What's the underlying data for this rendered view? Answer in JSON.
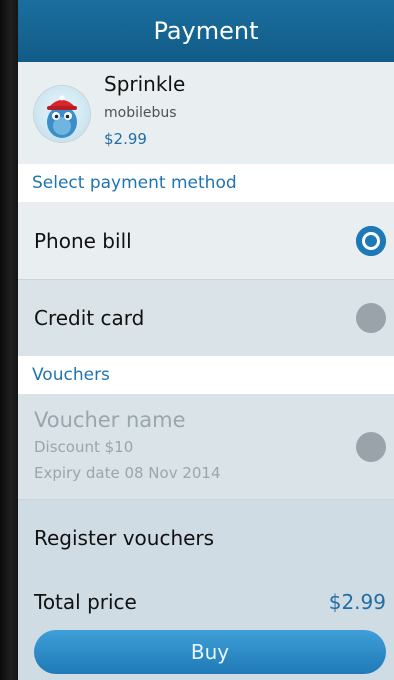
{
  "header": {
    "title": "Payment"
  },
  "app": {
    "name": "Sprinkle",
    "publisher": "mobilebus",
    "price": "$2.99",
    "icon": "sprinkle-mascot-icon"
  },
  "payment_method": {
    "section_label": "Select payment method",
    "options": [
      {
        "label": "Phone bill",
        "selected": true
      },
      {
        "label": "Credit card",
        "selected": false
      }
    ]
  },
  "vouchers": {
    "section_label": "Vouchers",
    "item": {
      "name": "Voucher name",
      "discount": "Discount $10",
      "expiry": "Expiry date 08 Nov 2014",
      "selected": false,
      "disabled": true
    },
    "register_label": "Register vouchers"
  },
  "total": {
    "label": "Total price",
    "value": "$2.99"
  },
  "buy": {
    "label": "Buy"
  },
  "colors": {
    "header": "#1a6f9f",
    "accent": "#1f74b2",
    "radio_off": "#9aa3a9",
    "background": "#dfe6ea"
  }
}
